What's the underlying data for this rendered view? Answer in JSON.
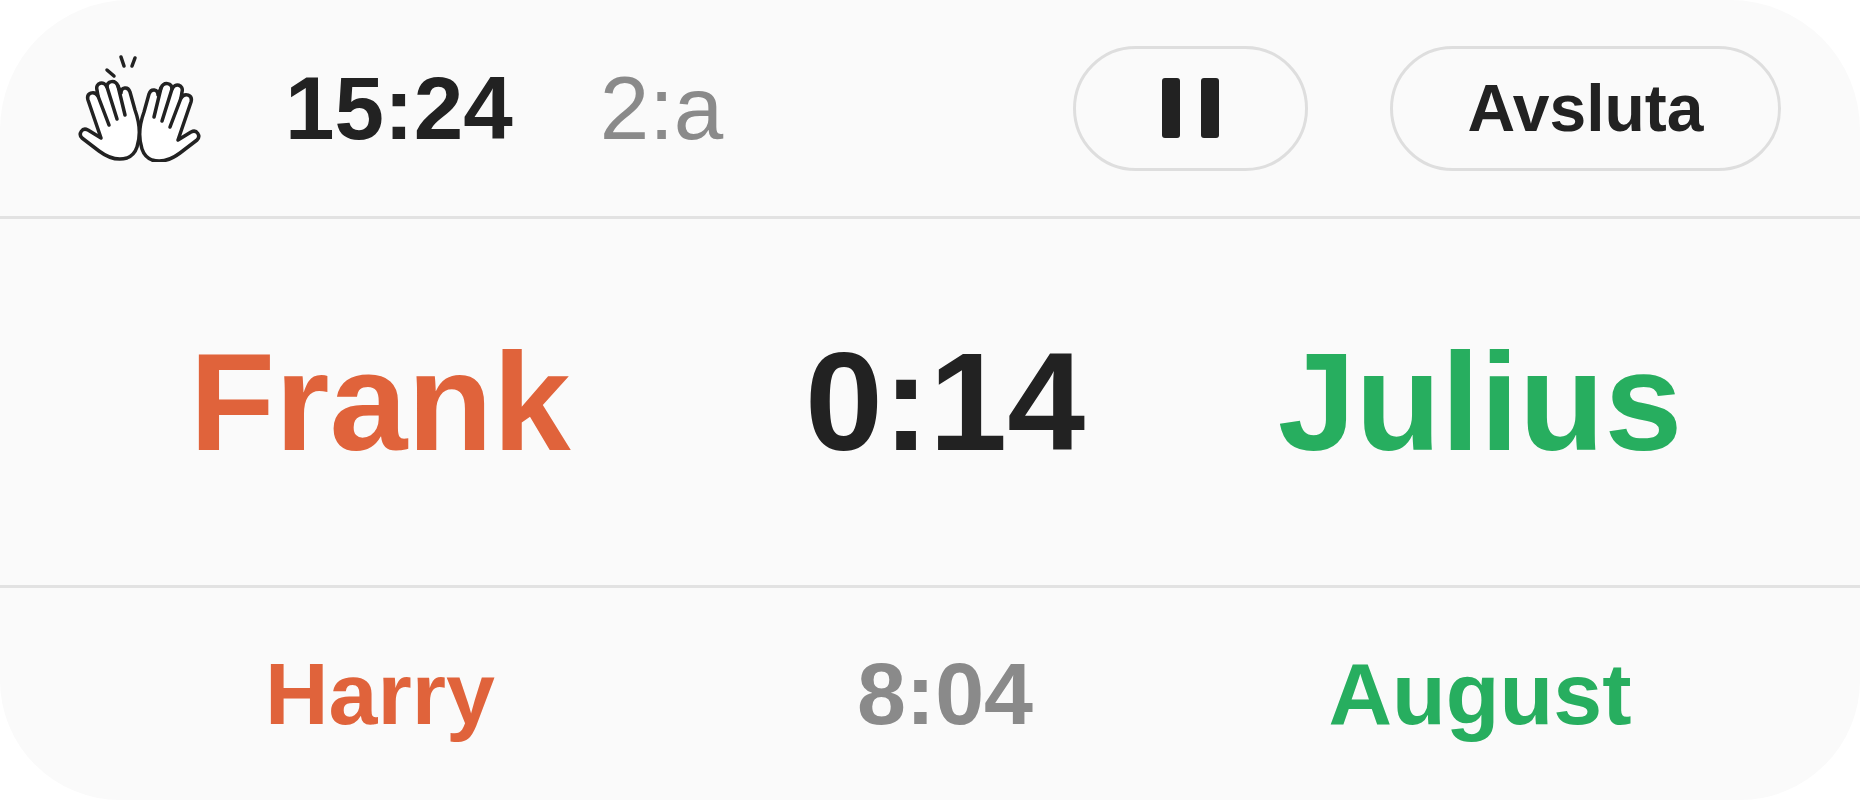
{
  "header": {
    "clock": "15:24",
    "round": "2:a",
    "end_button": {
      "label": "Avsluta"
    }
  },
  "current_match": {
    "players": [
      {
        "name": "Frank",
        "color": "#e0633b"
      },
      {
        "name": "Julius",
        "color": "#27ae5f"
      }
    ],
    "time": "0:14"
  },
  "next_match": {
    "players": [
      {
        "name": "Harry",
        "color": "#e0633b"
      },
      {
        "name": "August",
        "color": "#27ae5f"
      }
    ],
    "time": "8:04"
  }
}
